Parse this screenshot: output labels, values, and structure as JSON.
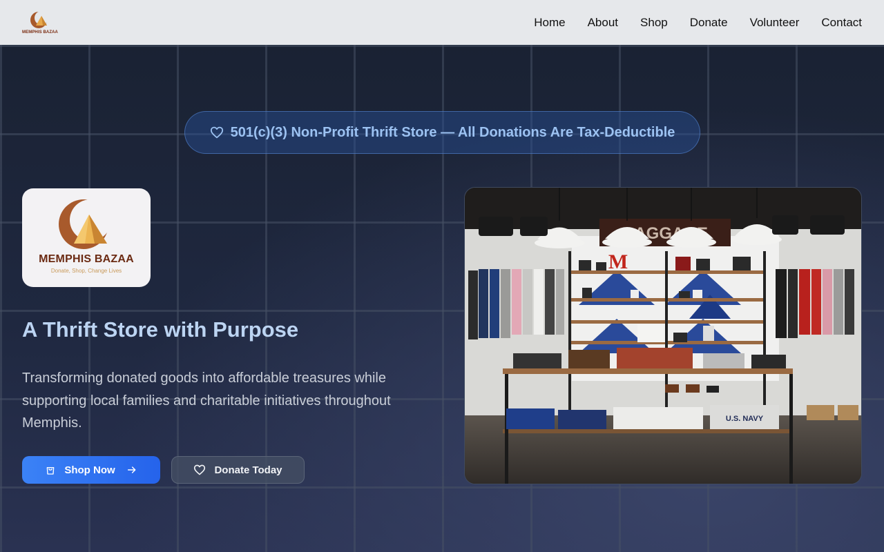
{
  "header": {
    "logo_alt": "Memphis Bazaar",
    "logo_wordmark": "MEMPHIS BAZAA",
    "nav": [
      "Home",
      "About",
      "Shop",
      "Donate",
      "Volunteer",
      "Contact"
    ]
  },
  "badge": {
    "icon": "heart-icon",
    "text": "501(c)(3) Non-Profit Thrift Store — All Donations Are Tax-Deductible"
  },
  "logo_card": {
    "title": "MEMPHIS BAZAA",
    "tagline": "Donate, Shop, Change Lives"
  },
  "hero": {
    "title": "A Thrift Store with Purpose",
    "description": "Transforming donated goods into affordable treasures while supporting local families and charitable initiatives throughout Memphis."
  },
  "buttons": {
    "primary_label": "Shop Now",
    "primary_icon": "shopping-bag-icon",
    "primary_trailing_icon": "arrow-right-icon",
    "secondary_label": "Donate Today",
    "secondary_icon": "heart-icon"
  },
  "image": {
    "alt": "Interior of a thrift store with clothing racks, shelves and pendant lamps",
    "sign_text": "BAGGAGE",
    "shirt_text": "U.S. NAVY"
  },
  "colors": {
    "header_bg": "#e6e8eb",
    "accent": "#3b82f6",
    "badge_text": "#9cc2f2",
    "title": "#bcd4f2",
    "brand": "#6b2a12"
  }
}
